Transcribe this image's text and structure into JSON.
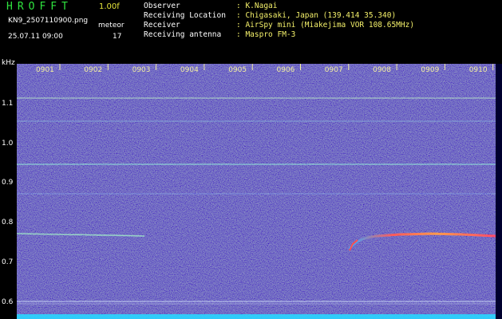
{
  "header": {
    "logo": "HROFFT",
    "version": "1.00f",
    "filename": "KN9_2507110900.png",
    "meteor_label": "meteor",
    "datetime": "25.07.11 09:00",
    "meteor_count": "17"
  },
  "info": [
    {
      "key": "Observer",
      "value": ": K.Nagai"
    },
    {
      "key": "Receiving Location",
      "value": ": Chigasaki, Japan (139.414 35.340)"
    },
    {
      "key": "Receiver",
      "value": ": AirSpy mini (Miakejima VOR 108.65MHz)"
    },
    {
      "key": "Receiving antenna",
      "value": ": Maspro FM-3"
    }
  ],
  "axis": {
    "y_unit": "kHz",
    "y_ticks": [
      "1.1",
      "1.0",
      "0.9",
      "0.8",
      "0.7",
      "0.6"
    ],
    "x_ticks": [
      "0901",
      "0902",
      "0903",
      "0904",
      "0905",
      "0906",
      "0907",
      "0908",
      "0909",
      "0910"
    ]
  },
  "colors": {
    "background": "#000000",
    "spectrum_base": "#1b1d8c",
    "accent_green": "#2fe33f",
    "label_yellow": "#f4f06a"
  }
}
